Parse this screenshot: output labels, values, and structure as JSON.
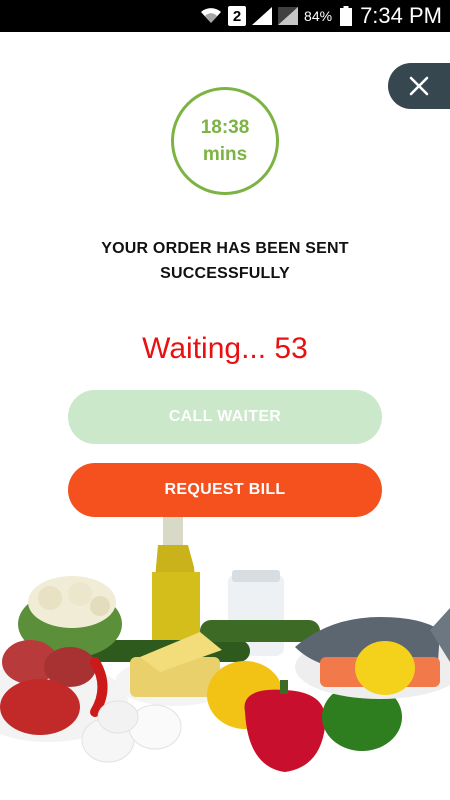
{
  "status_bar": {
    "sim_number": "2",
    "battery_percent": "84%",
    "time": "7:34 PM"
  },
  "timer": {
    "time": "18:38",
    "unit": "mins"
  },
  "order_status": {
    "line1": "YOUR ORDER HAS BEEN SENT",
    "line2": "SUCCESSFULLY"
  },
  "waiting_text": "Waiting... 53",
  "buttons": {
    "call_waiter": "CALL WAITER",
    "request_bill": "REQUEST BILL"
  },
  "colors": {
    "timer_green": "#7cb342",
    "waiting_red": "#e81010",
    "call_waiter_bg": "#cbe8cb",
    "request_bill_bg": "#f4511e",
    "close_bg": "#37474f"
  },
  "icons": {
    "close": "close-icon",
    "wifi": "wifi-icon",
    "signal": "signal-icon",
    "battery": "battery-icon"
  }
}
